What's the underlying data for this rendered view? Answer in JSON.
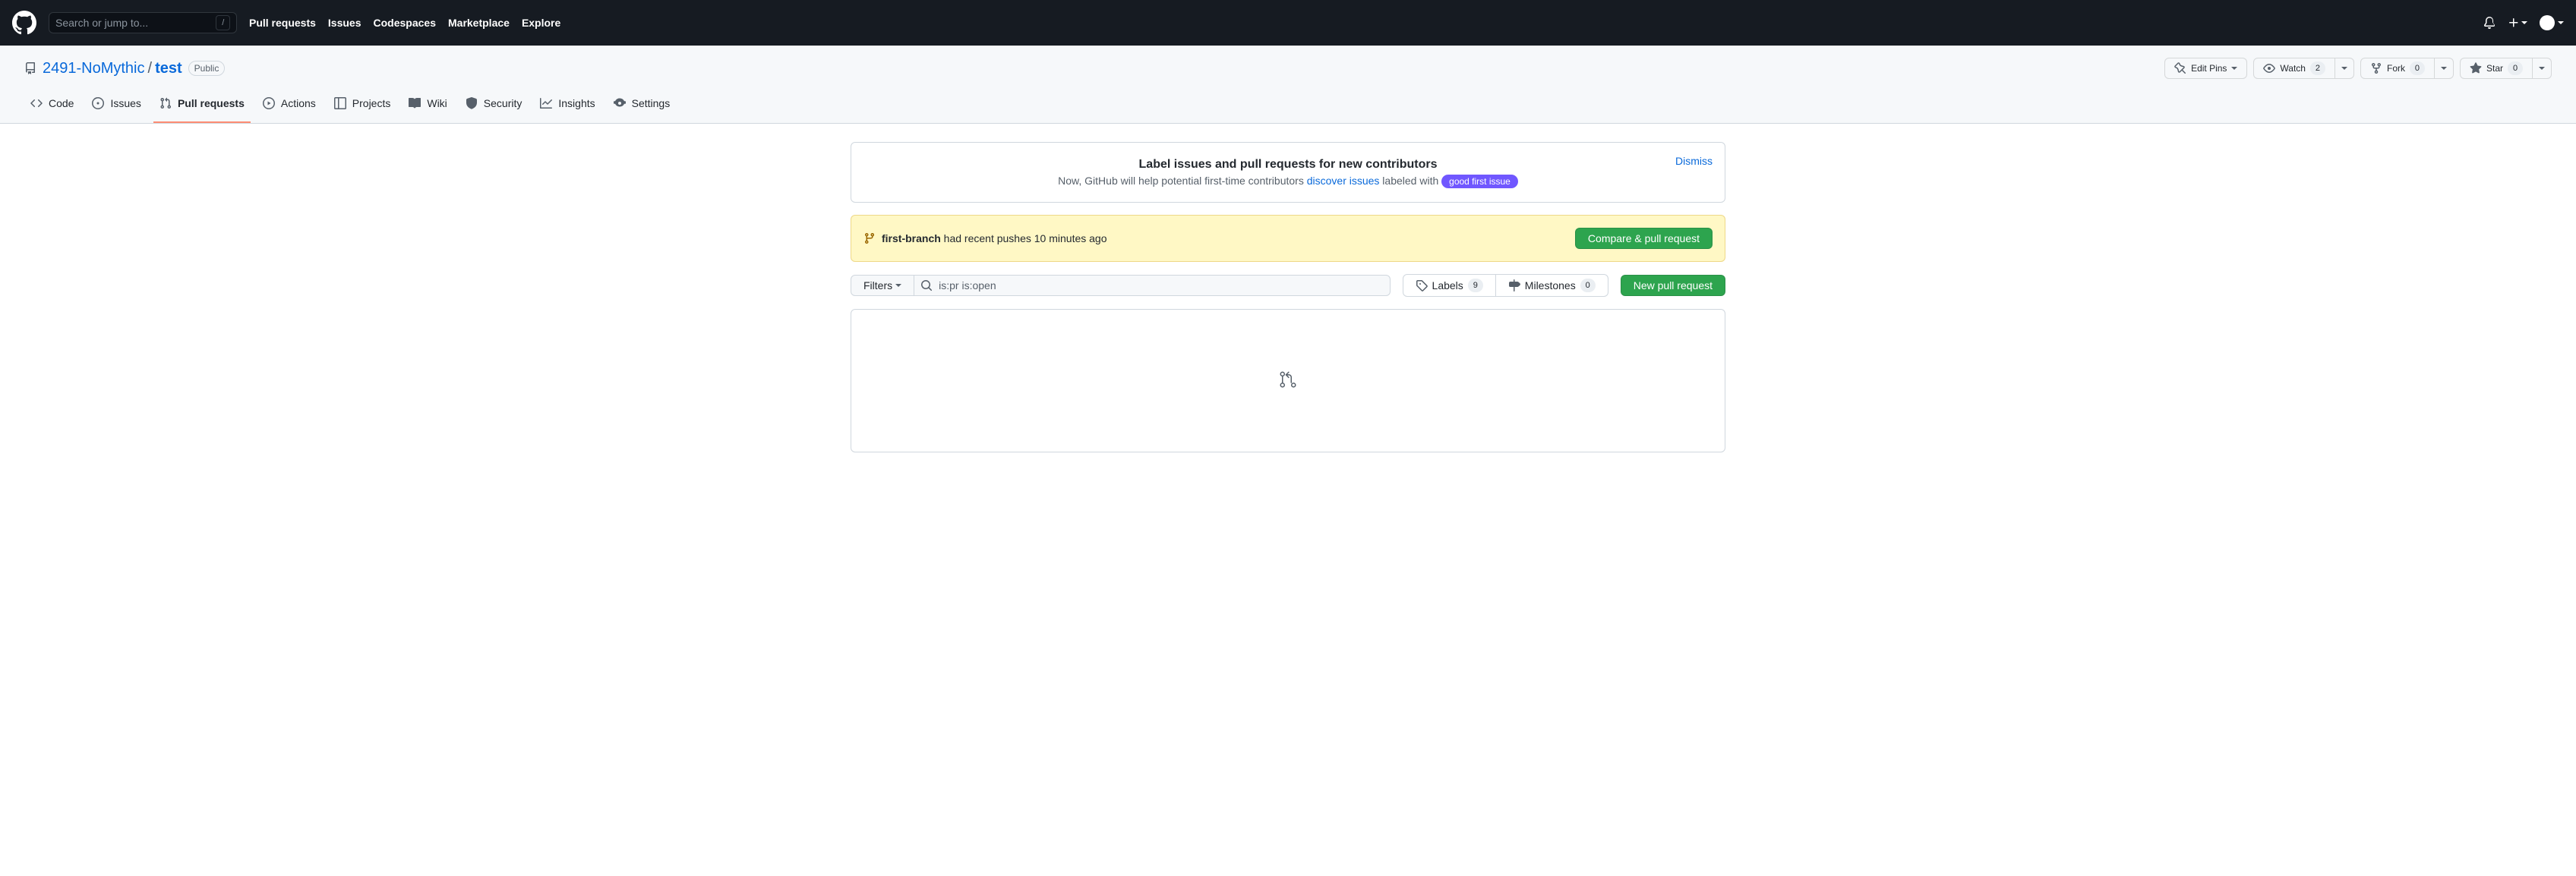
{
  "header": {
    "search_placeholder": "Search or jump to...",
    "slash": "/",
    "nav": {
      "pull_requests": "Pull requests",
      "issues": "Issues",
      "codespaces": "Codespaces",
      "marketplace": "Marketplace",
      "explore": "Explore"
    }
  },
  "repo": {
    "owner": "2491-NoMythic",
    "name": "test",
    "visibility": "Public",
    "actions": {
      "edit_pins": "Edit Pins",
      "watch": "Watch",
      "watch_count": "2",
      "fork": "Fork",
      "fork_count": "0",
      "star": "Star",
      "star_count": "0"
    }
  },
  "tabs": {
    "code": "Code",
    "issues": "Issues",
    "pull_requests": "Pull requests",
    "actions": "Actions",
    "projects": "Projects",
    "wiki": "Wiki",
    "security": "Security",
    "insights": "Insights",
    "settings": "Settings"
  },
  "notice": {
    "title": "Label issues and pull requests for new contributors",
    "text_before": "Now, GitHub will help potential first-time contributors ",
    "link": "discover issues",
    "text_after": " labeled with ",
    "label": "good first issue",
    "dismiss": "Dismiss"
  },
  "flash": {
    "branch": "first-branch",
    "text": " had recent pushes 10 minutes ago",
    "button": "Compare & pull request"
  },
  "filters": {
    "filters_label": "Filters",
    "search_value": "is:pr is:open",
    "labels": "Labels",
    "labels_count": "9",
    "milestones": "Milestones",
    "milestones_count": "0",
    "new_pr": "New pull request"
  }
}
